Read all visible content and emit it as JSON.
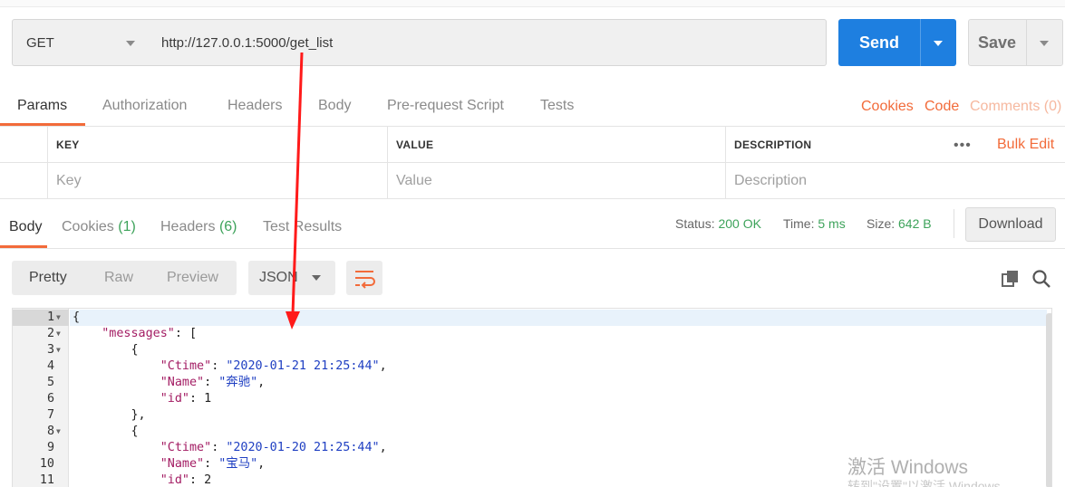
{
  "request": {
    "method": "GET",
    "url": "http://127.0.0.1:5000/get_list",
    "send_label": "Send",
    "save_label": "Save"
  },
  "request_tabs": {
    "params": "Params",
    "authorization": "Authorization",
    "headers": "Headers",
    "body": "Body",
    "pre_request": "Pre-request Script",
    "tests": "Tests",
    "cookies": "Cookies",
    "code": "Code",
    "comments": "Comments (0)"
  },
  "params_table": {
    "headers": [
      "KEY",
      "VALUE",
      "DESCRIPTION"
    ],
    "placeholders": [
      "Key",
      "Value",
      "Description"
    ],
    "bulk_edit": "Bulk Edit",
    "more": "•••"
  },
  "response_tabs": {
    "body": "Body",
    "cookies": "Cookies",
    "cookies_count": "(1)",
    "headers": "Headers",
    "headers_count": "(6)",
    "test_results": "Test Results"
  },
  "response_meta": {
    "status_label": "Status:",
    "status_value": "200 OK",
    "time_label": "Time:",
    "time_value": "5 ms",
    "size_label": "Size:",
    "size_value": "642 B",
    "download_label": "Download"
  },
  "format_toolbar": {
    "pretty": "Pretty",
    "raw": "Raw",
    "preview": "Preview",
    "format": "JSON"
  },
  "code_lines": {
    "numbers": [
      "1",
      "2",
      "3",
      "4",
      "5",
      "6",
      "7",
      "8",
      "9",
      "10",
      "11"
    ],
    "l1_brace": "{",
    "l2_key": "\"messages\"",
    "l2_rest": ": [",
    "l3": "{",
    "l4_key": "\"Ctime\"",
    "l4_val": "\"2020-01-21 21:25:44\"",
    "l5_key": "\"Name\"",
    "l5_val": "\"奔驰\"",
    "l6_key": "\"id\"",
    "l6_val": "1",
    "l7": "},",
    "l8": "{",
    "l9_key": "\"Ctime\"",
    "l9_val": "\"2020-01-20 21:25:44\"",
    "l10_key": "\"Name\"",
    "l10_val": "\"宝马\"",
    "l11_key": "\"id\"",
    "l11_val": "2"
  },
  "watermark": {
    "line1": "激活 Windows",
    "line2": "转到\"设置\"以激活 Windows。"
  },
  "colors": {
    "accent": "#f26b3a",
    "send_blue": "#1e7fe0",
    "status_green": "#3ea35b",
    "annotation_red": "#ff1a1a"
  }
}
